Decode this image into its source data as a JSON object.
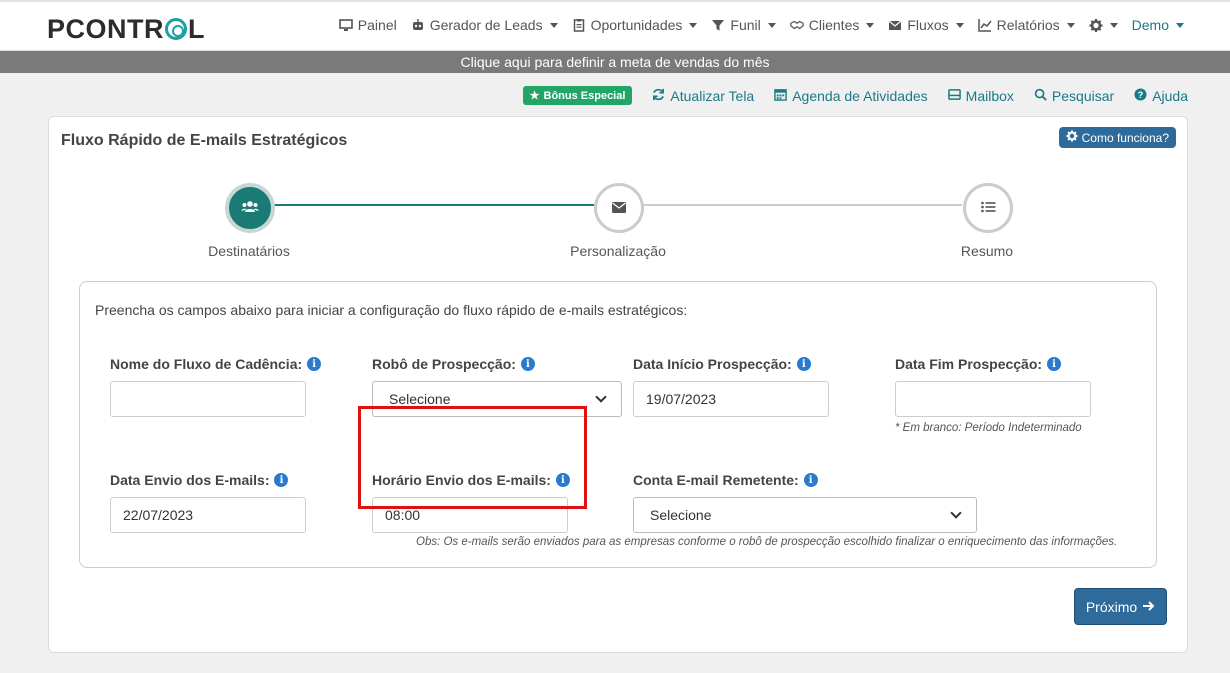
{
  "brand": {
    "logo_text_left": "P",
    "logo_text_mid": "CONTR",
    "logo_text_right": "L"
  },
  "nav": {
    "items": [
      {
        "label": "Painel",
        "icon": "monitor-icon",
        "dropdown": false
      },
      {
        "label": "Gerador de Leads",
        "icon": "robot-icon",
        "dropdown": true
      },
      {
        "label": "Oportunidades",
        "icon": "clipboard-icon",
        "dropdown": true
      },
      {
        "label": "Funil",
        "icon": "filter-icon",
        "dropdown": true
      },
      {
        "label": "Clientes",
        "icon": "handshake-icon",
        "dropdown": true
      },
      {
        "label": "Fluxos",
        "icon": "envelope-icon",
        "dropdown": true
      },
      {
        "label": "Relatórios",
        "icon": "chart-icon",
        "dropdown": true
      }
    ],
    "settings_icon": "gear-icon",
    "user": "Demo"
  },
  "goal_banner": "Clique aqui para definir a meta de vendas do mês",
  "toolbar": {
    "bonus": "Bônus Especial",
    "refresh": "Atualizar Tela",
    "agenda": "Agenda de Atividades",
    "mailbox": "Mailbox",
    "search": "Pesquisar",
    "help": "Ajuda"
  },
  "panel": {
    "title": "Fluxo Rápido de E-mails Estratégicos",
    "how_it_works": "Como funciona?"
  },
  "steps": [
    {
      "label": "Destinatários",
      "icon": "users-icon",
      "state": "active"
    },
    {
      "label": "Personalização",
      "icon": "envelope-icon",
      "state": "pending"
    },
    {
      "label": "Resumo",
      "icon": "list-icon",
      "state": "pending"
    }
  ],
  "form": {
    "intro": "Preencha os campos abaixo para iniciar a configuração do fluxo rápido de e-mails estratégicos:",
    "flow_name": {
      "label": "Nome do Fluxo de Cadência:",
      "value": ""
    },
    "robot": {
      "label": "Robô de Prospecção:",
      "value": "Selecione"
    },
    "start_date": {
      "label": "Data Início Prospecção:",
      "value": "19/07/2023"
    },
    "end_date": {
      "label": "Data Fim Prospecção:",
      "value": "",
      "hint": "* Em branco: Período Indeterminado"
    },
    "send_date": {
      "label": "Data Envio dos E-mails:",
      "value": "22/07/2023"
    },
    "send_time": {
      "label": "Horário Envio dos E-mails:",
      "value": "08:00"
    },
    "sender": {
      "label": "Conta E-mail Remetente:",
      "value": "Selecione"
    },
    "note": "Obs: Os e-mails serão enviados para as empresas conforme o robô de prospecção escolhido finalizar o enriquecimento das informações."
  },
  "next_button": "Próximo",
  "colors": {
    "teal": "#1a7a74",
    "button_blue": "#2e6b9b",
    "bonus_green": "#22a567",
    "highlight_red": "#e01010"
  }
}
